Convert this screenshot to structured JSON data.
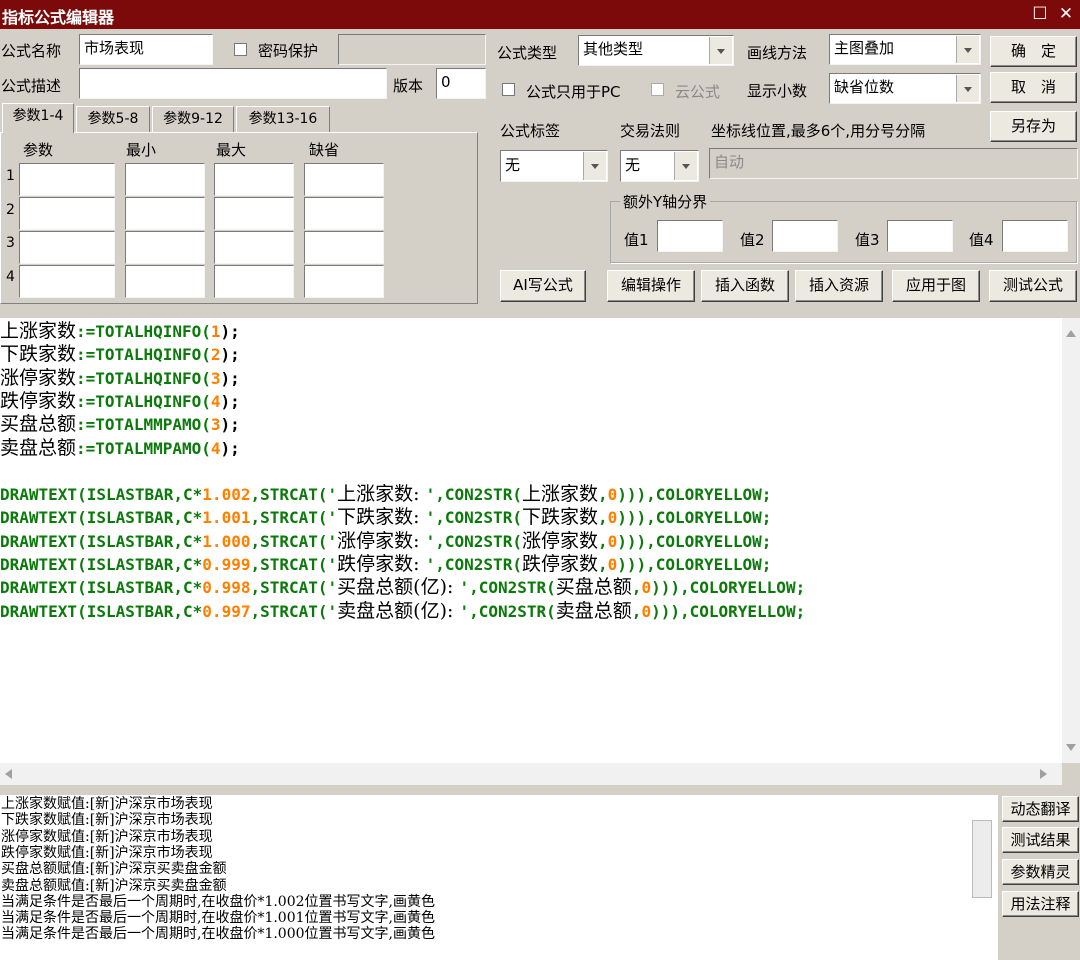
{
  "window": {
    "title": "指标公式编辑器"
  },
  "form": {
    "name_label": "公式名称",
    "name_value": "市场表现",
    "password_label": "密码保护",
    "type_label": "公式类型",
    "type_value": "其他类型",
    "draw_label": "画线方法",
    "draw_value": "主图叠加",
    "desc_label": "公式描述",
    "version_label": "版本",
    "version_value": "0",
    "pc_only_label": "公式只用于PC",
    "cloud_label": "云公式",
    "decimals_label": "显示小数",
    "decimals_value": "缺省位数",
    "tag_label": "公式标签",
    "tag_value": "无",
    "trade_label": "交易法则",
    "trade_value": "无",
    "axis_label": "坐标线位置,最多6个,用分号分隔",
    "axis_value": "自动",
    "extra_y_label": "额外Y轴分界",
    "val_labels": [
      "值1",
      "值2",
      "值3",
      "值4"
    ]
  },
  "buttons": {
    "ok": "确　定",
    "cancel": "取　消",
    "save_as": "另存为",
    "ai": "AI写公式",
    "edit": "编辑操作",
    "insert_fn": "插入函数",
    "insert_res": "插入资源",
    "apply": "应用于图",
    "test": "测试公式"
  },
  "tabs": [
    "参数1-4",
    "参数5-8",
    "参数9-12",
    "参数13-16"
  ],
  "params": {
    "headers": [
      "参数",
      "最小",
      "最大",
      "缺省"
    ],
    "rows": [
      "1",
      "2",
      "3",
      "4"
    ]
  },
  "code": [
    {
      "cn": "上涨家数",
      "rest": [
        {
          "t": ":=TOTALHQINFO(",
          "c": "g"
        },
        {
          "t": "1",
          "c": "n"
        },
        {
          "t": ");",
          "c": "o"
        }
      ]
    },
    {
      "cn": "下跌家数",
      "rest": [
        {
          "t": ":=TOTALHQINFO(",
          "c": "g"
        },
        {
          "t": "2",
          "c": "n"
        },
        {
          "t": ");",
          "c": "o"
        }
      ]
    },
    {
      "cn": "涨停家数",
      "rest": [
        {
          "t": ":=TOTALHQINFO(",
          "c": "g"
        },
        {
          "t": "3",
          "c": "n"
        },
        {
          "t": ");",
          "c": "o"
        }
      ]
    },
    {
      "cn": "跌停家数",
      "rest": [
        {
          "t": ":=TOTALHQINFO(",
          "c": "g"
        },
        {
          "t": "4",
          "c": "n"
        },
        {
          "t": ");",
          "c": "o"
        }
      ]
    },
    {
      "cn": "买盘总额",
      "rest": [
        {
          "t": ":=TOTALMMPAMO(",
          "c": "g"
        },
        {
          "t": "3",
          "c": "n"
        },
        {
          "t": ");",
          "c": "o"
        }
      ]
    },
    {
      "cn": "卖盘总额",
      "rest": [
        {
          "t": ":=TOTALMMPAMO(",
          "c": "g"
        },
        {
          "t": "4",
          "c": "n"
        },
        {
          "t": ");",
          "c": "o"
        }
      ]
    },
    {
      "cn": "",
      "rest": []
    },
    {
      "cn": "",
      "rest": [
        {
          "t": "DRAWTEXT(ISLASTBAR,C*",
          "c": "g"
        },
        {
          "t": "1.002",
          "c": "n"
        },
        {
          "t": ",STRCAT('",
          "c": "g"
        },
        {
          "t": "上涨家数: ",
          "c": "z"
        },
        {
          "t": "',CON2STR(",
          "c": "g"
        },
        {
          "t": "上涨家数",
          "c": "z"
        },
        {
          "t": ",",
          "c": "g"
        },
        {
          "t": "0",
          "c": "n"
        },
        {
          "t": "))),COLORYELLOW;",
          "c": "g"
        }
      ]
    },
    {
      "cn": "",
      "rest": [
        {
          "t": "DRAWTEXT(ISLASTBAR,C*",
          "c": "g"
        },
        {
          "t": "1.001",
          "c": "n"
        },
        {
          "t": ",STRCAT('",
          "c": "g"
        },
        {
          "t": "下跌家数: ",
          "c": "z"
        },
        {
          "t": "',CON2STR(",
          "c": "g"
        },
        {
          "t": "下跌家数",
          "c": "z"
        },
        {
          "t": ",",
          "c": "g"
        },
        {
          "t": "0",
          "c": "n"
        },
        {
          "t": "))),COLORYELLOW;",
          "c": "g"
        }
      ]
    },
    {
      "cn": "",
      "rest": [
        {
          "t": "DRAWTEXT(ISLASTBAR,C*",
          "c": "g"
        },
        {
          "t": "1.000",
          "c": "n"
        },
        {
          "t": ",STRCAT('",
          "c": "g"
        },
        {
          "t": "涨停家数: ",
          "c": "z"
        },
        {
          "t": "',CON2STR(",
          "c": "g"
        },
        {
          "t": "涨停家数",
          "c": "z"
        },
        {
          "t": ",",
          "c": "g"
        },
        {
          "t": "0",
          "c": "n"
        },
        {
          "t": "))),COLORYELLOW;",
          "c": "g"
        }
      ]
    },
    {
      "cn": "",
      "rest": [
        {
          "t": "DRAWTEXT(ISLASTBAR,C*",
          "c": "g"
        },
        {
          "t": "0.999",
          "c": "n"
        },
        {
          "t": ",STRCAT('",
          "c": "g"
        },
        {
          "t": "跌停家数: ",
          "c": "z"
        },
        {
          "t": "',CON2STR(",
          "c": "g"
        },
        {
          "t": "跌停家数",
          "c": "z"
        },
        {
          "t": ",",
          "c": "g"
        },
        {
          "t": "0",
          "c": "n"
        },
        {
          "t": "))),COLORYELLOW;",
          "c": "g"
        }
      ]
    },
    {
      "cn": "",
      "rest": [
        {
          "t": "DRAWTEXT(ISLASTBAR,C*",
          "c": "g"
        },
        {
          "t": "0.998",
          "c": "n"
        },
        {
          "t": ",STRCAT('",
          "c": "g"
        },
        {
          "t": "买盘总额(亿): ",
          "c": "z"
        },
        {
          "t": "',CON2STR(",
          "c": "g"
        },
        {
          "t": "买盘总额",
          "c": "z"
        },
        {
          "t": ",",
          "c": "g"
        },
        {
          "t": "0",
          "c": "n"
        },
        {
          "t": "))),COLORYELLOW;",
          "c": "g"
        }
      ]
    },
    {
      "cn": "",
      "rest": [
        {
          "t": "DRAWTEXT(ISLASTBAR,C*",
          "c": "g"
        },
        {
          "t": "0.997",
          "c": "n"
        },
        {
          "t": ",STRCAT('",
          "c": "g"
        },
        {
          "t": "卖盘总额(亿): ",
          "c": "z"
        },
        {
          "t": "',CON2STR(",
          "c": "g"
        },
        {
          "t": "卖盘总额",
          "c": "z"
        },
        {
          "t": ",",
          "c": "g"
        },
        {
          "t": "0",
          "c": "n"
        },
        {
          "t": "))),COLORYELLOW;",
          "c": "g"
        }
      ]
    }
  ],
  "output": [
    "上涨家数赋值:[新]沪深京市场表现",
    "下跌家数赋值:[新]沪深京市场表现",
    "涨停家数赋值:[新]沪深京市场表现",
    "跌停家数赋值:[新]沪深京市场表现",
    "买盘总额赋值:[新]沪深京买卖盘金额",
    "卖盘总额赋值:[新]沪深京买卖盘金额",
    "当满足条件是否最后一个周期时,在收盘价*1.002位置书写文字,画黄色",
    "当满足条件是否最后一个周期时,在收盘价*1.001位置书写文字,画黄色",
    "当满足条件是否最后一个周期时,在收盘价*1.000位置书写文字,画黄色"
  ],
  "side_buttons": [
    "动态翻译",
    "测试结果",
    "参数精灵",
    "用法注释"
  ],
  "colors": {
    "titlebar": "#7c0a0a",
    "code_green": "#0b7a0b",
    "code_number": "#ff7f00",
    "window_bg": "#d4d0c8"
  }
}
